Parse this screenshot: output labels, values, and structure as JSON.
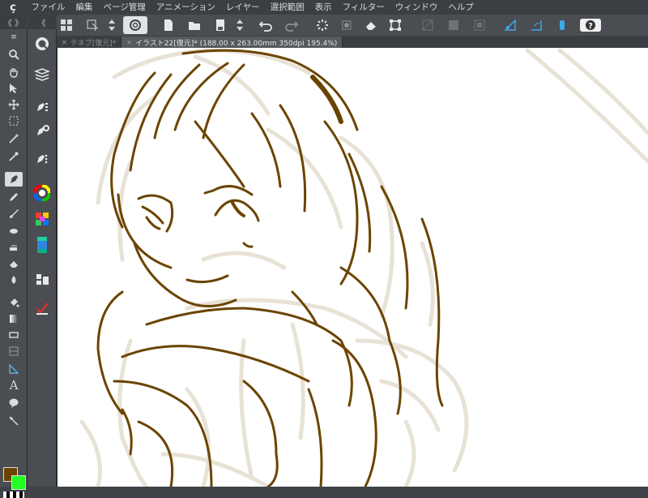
{
  "app": {
    "logo": "ç"
  },
  "menu": [
    "ファイル",
    "編集",
    "ページ管理",
    "アニメーション",
    "レイヤー",
    "選択範囲",
    "表示",
    "フィルター",
    "ウィンドウ",
    "ヘルプ"
  ],
  "panel_collapse": {
    "left": "《 》",
    "right": "《"
  },
  "tabs": [
    {
      "label": "テネブ[復元]*",
      "active": false
    },
    {
      "label": "イラスト22[復元]* (188.00 x 263.00mm 350dpi 195.4%)",
      "active": true
    }
  ],
  "tools_text": {
    "text_tool": "A"
  },
  "colors": {
    "main": "#6b4400",
    "sub": "#22ff22",
    "accent_ui": "#3f4347",
    "line_brown": "#6b4400",
    "sketch_beige": "#e8e2d6"
  }
}
